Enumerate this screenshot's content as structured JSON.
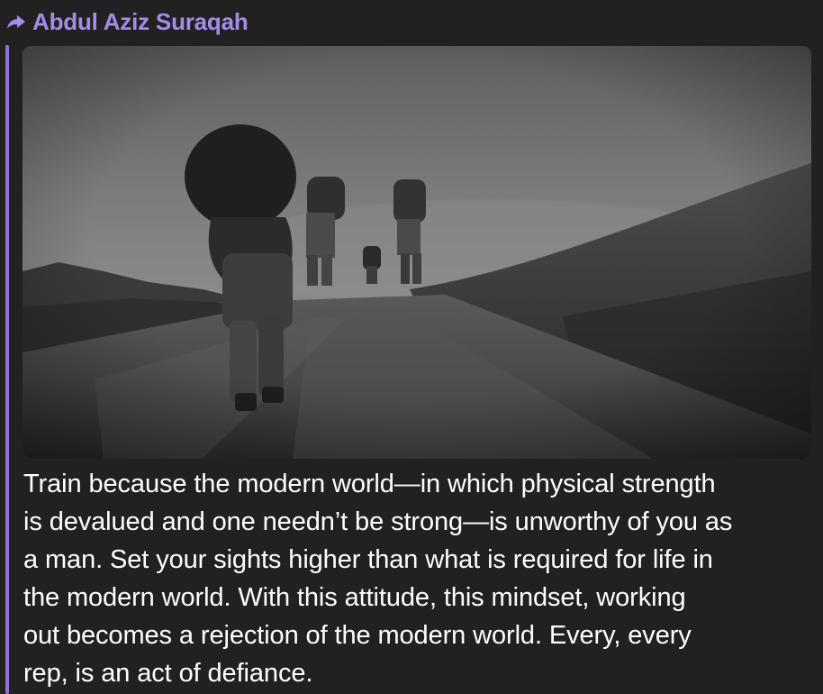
{
  "post": {
    "forward_icon": "forward-arrow-icon",
    "forwarded_from": "Abdul Aziz Suraqah",
    "accent_color": "#a58bea",
    "bar_color": "#8c74d8",
    "background_color": "#212121",
    "photo_alt": "Soldiers with heavy backpacks walking up a dirt road under an overcast sky",
    "caption": "Train because the modern world—in which physical strength\nis devalued and one needn’t be strong—is unworthy of you as\na man. Set your sights higher than what is required for life in\nthe modern world. With this attitude, this mindset, working\nout becomes a rejection of the modern world. Every, every\nrep, is an act of defiance."
  }
}
